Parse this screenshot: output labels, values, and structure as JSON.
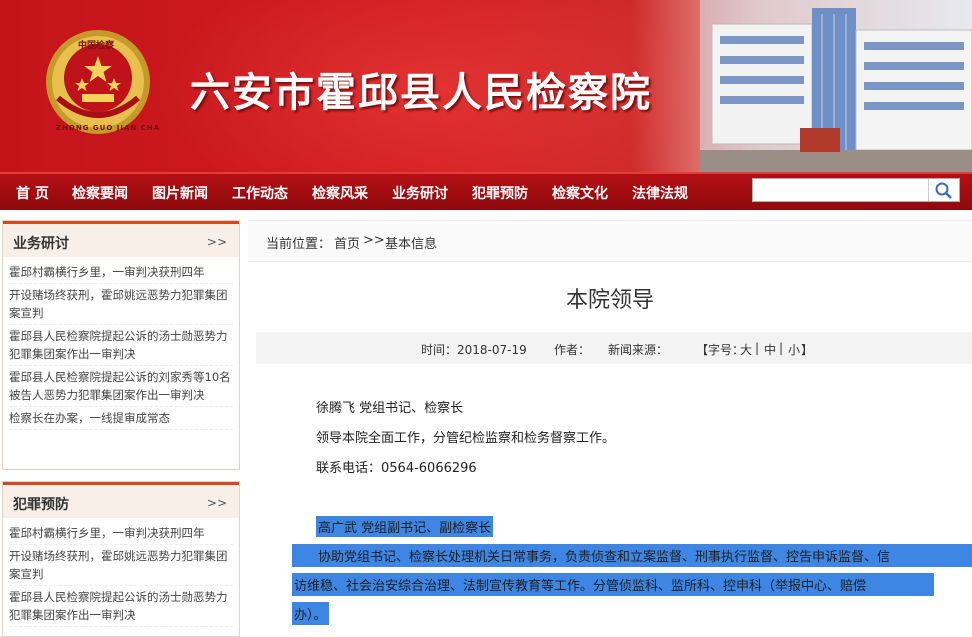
{
  "site": {
    "title": "六安市霍邱县人民检察院",
    "emblem_text": "中国检察",
    "emblem_ring": "ZHONG GUO JIAN CHA"
  },
  "nav": {
    "items": [
      "首 页",
      "检察要闻",
      "图片新闻",
      "工作动态",
      "检察风采",
      "业务研讨",
      "犯罪预防",
      "检察文化",
      "法律法规"
    ],
    "search_placeholder": ""
  },
  "sidebar": {
    "panels": [
      {
        "title": "业务研讨",
        "more": ">>",
        "items": [
          "霍邱村霸横行乡里，一审判决获刑四年",
          "开设赌场终获刑，霍邱姚远恶势力犯罪集团案宣判",
          "霍邱县人民检察院提起公诉的汤士勋恶势力犯罪集团案作出一审判决",
          "霍邱县人民检察院提起公诉的刘家秀等10名被告人恶势力犯罪集团案作出一审判决",
          "检察长在办案，一线提审成常态"
        ]
      },
      {
        "title": "犯罪预防",
        "more": ">>",
        "items": [
          "霍邱村霸横行乡里，一审判决获刑四年",
          "开设赌场终获刑，霍邱姚远恶势力犯罪集团案宣判",
          "霍邱县人民检察院提起公诉的汤士勋恶势力犯罪集团案作出一审判决"
        ]
      }
    ]
  },
  "breadcrumb": {
    "label": "当前位置：",
    "home": "首页",
    "sep": ">>",
    "current": "基本信息"
  },
  "article": {
    "title": "本院领导",
    "meta": {
      "time": "时间：2018-07-19",
      "author": "作者：",
      "source": "新闻来源：",
      "font_label": "【字号：",
      "font_large": "大",
      "font_mid": "中",
      "font_small": "小",
      "font_end": "】",
      "bar": "|"
    },
    "lines": [
      "徐腾飞  党组书记、检察长",
      "领导本院全面工作，分管纪检监察和检务督察工作。",
      "联系电话：0564-6066296",
      "高广武  党组副书记、副检察长",
      "协助党组书记、检察长处理机关日常事务，负责侦查和立案监督、刑事执行监督、控告申诉监督、信",
      "访维稳、社会治安综合治理、法制宣传教育等工作。分管侦监科、监所科、控申科（举报中心、赔偿",
      "办）。"
    ]
  },
  "colors": {
    "nav_bg": "#a50d12",
    "panel_accent": "#d44a1e",
    "selection": "#3d86e4"
  }
}
